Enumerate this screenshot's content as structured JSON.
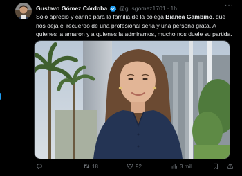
{
  "tweet": {
    "author_name": "Gustavo Gómez Córdoba",
    "handle": "@gusgomez1701",
    "separator": "·",
    "time": "1h",
    "text_part1": "Solo aprecio y cariño para la familia de la colega ",
    "text_mention": "Bianca Gambino",
    "text_part2": ", que nos deja el recuerdo de una profesional seria y una persona grata. A quienes la amaron y a quienes la admiramos, mucho nos duele su partida.",
    "more_label": "···"
  },
  "actions": {
    "reply_count": "",
    "retweet_count": "18",
    "like_count": "92",
    "views_count": "3 mil"
  },
  "colors": {
    "background": "#000000",
    "text": "#e7e9ea",
    "muted": "#71767b",
    "verified": "#1d9bf0"
  },
  "icons": [
    "verified-badge-icon",
    "more-icon",
    "reply-icon",
    "retweet-icon",
    "like-icon",
    "views-icon",
    "bookmark-icon",
    "share-icon"
  ]
}
